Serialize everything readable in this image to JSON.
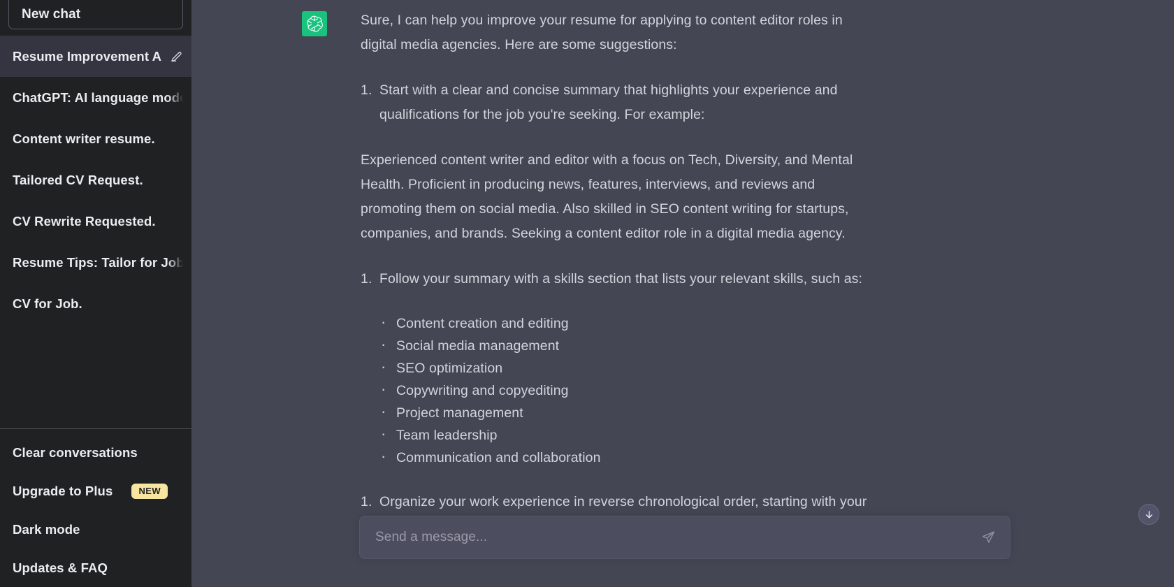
{
  "sidebar": {
    "new_chat_label": "New chat",
    "conversations": [
      {
        "label": "Resume Improvement A",
        "active": true
      },
      {
        "label": "ChatGPT: AI language model.",
        "active": false
      },
      {
        "label": "Content writer resume.",
        "active": false
      },
      {
        "label": "Tailored CV Request.",
        "active": false
      },
      {
        "label": "CV Rewrite Requested.",
        "active": false
      },
      {
        "label": "Resume Tips: Tailor for Job",
        "active": false
      },
      {
        "label": "CV for Job.",
        "active": false
      }
    ],
    "conversation_actions": {
      "edit_icon": "pencil-icon",
      "delete_icon": "trash-icon"
    },
    "menu": [
      {
        "label": "Clear conversations",
        "badge": null
      },
      {
        "label": "Upgrade to Plus",
        "badge": "NEW"
      },
      {
        "label": "Dark mode",
        "badge": null
      },
      {
        "label": "Updates & FAQ",
        "badge": null
      }
    ]
  },
  "message": {
    "avatar_icon": "chatgpt-logo-icon",
    "intro": "Sure, I can help you improve your resume for applying to content editor roles in digital media agencies. Here are some suggestions:",
    "step1": "Start with a clear and concise summary that highlights your experience and qualifications for the job you're seeking. For example:",
    "example": "Experienced content writer and editor with a focus on Tech, Diversity, and Mental Health. Proficient in producing news, features, interviews, and reviews and promoting them on social media. Also skilled in SEO content writing for startups, companies, and brands. Seeking a content editor role in a digital media agency.",
    "step2": "Follow your summary with a skills section that lists your relevant skills, such as:",
    "skills": [
      "Content creation and editing",
      "Social media management",
      "SEO optimization",
      "Copywriting and copyediting",
      "Project management",
      "Team leadership",
      "Communication and collaboration"
    ],
    "step3": "Organize your work experience in reverse chronological order, starting with your most recent job. For each job, include the following details:",
    "actions": {
      "thumbs_up_icon": "thumbs-up-icon",
      "thumbs_down_icon": "thumbs-down-icon"
    }
  },
  "composer": {
    "placeholder": "Send a message...",
    "value": "",
    "send_icon": "send-paper-plane-icon"
  },
  "scroll_down": {
    "icon": "arrow-down-icon"
  },
  "colors": {
    "sidebar_bg": "#202123",
    "sidebar_active": "#343541",
    "main_bg": "#444654",
    "accent_green": "#19c37d",
    "badge_yellow": "#f8e6a0",
    "text_primary": "#ececf1",
    "text_body": "#d1d5db"
  }
}
